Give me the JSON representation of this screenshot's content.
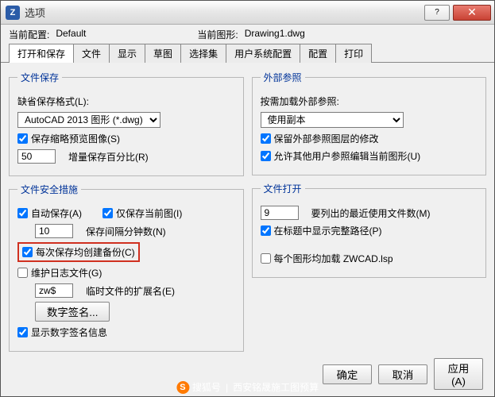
{
  "window": {
    "title": "选项"
  },
  "info": {
    "currentProfileLabel": "当前配置:",
    "currentProfileValue": "Default",
    "currentDrawingLabel": "当前图形:",
    "currentDrawingValue": "Drawing1.dwg"
  },
  "tabs": [
    "打开和保存",
    "文件",
    "显示",
    "草图",
    "选择集",
    "用户系统配置",
    "配置",
    "打印"
  ],
  "left": {
    "fileSave": {
      "legend": "文件保存",
      "defaultFormatLabel": "缺省保存格式(L):",
      "format": "AutoCAD 2013 图形 (*.dwg)",
      "thumbnail": "保存缩略预览图像(S)",
      "incrementValue": "50",
      "incrementLabel": "增量保存百分比(R)"
    },
    "safety": {
      "legend": "文件安全措施",
      "autoSave": "自动保存(A)",
      "onlyCurrent": "仅保存当前图(I)",
      "intervalValue": "10",
      "intervalLabel": "保存间隔分钟数(N)",
      "backup": "每次保存均创建备份(C)",
      "logFile": "维护日志文件(G)",
      "tempExtValue": "zw$",
      "tempExtLabel": "临时文件的扩展名(E)",
      "signatureBtn": "数字签名...",
      "showSignature": "显示数字签名信息"
    }
  },
  "right": {
    "xref": {
      "legend": "外部参照",
      "loadLabel": "按需加载外部参照:",
      "loadValue": "使用副本",
      "retainLayers": "保留外部参照图层的修改",
      "allowEdit": "允许其他用户参照编辑当前图形(U)"
    },
    "fileOpen": {
      "legend": "文件打开",
      "recentValue": "9",
      "recentLabel": "要列出的最近使用文件数(M)",
      "fullPath": "在标题中显示完整路径(P)",
      "loadLsp": "每个图形均加载 ZWCAD.lsp"
    }
  },
  "footer": {
    "ok": "确定",
    "cancel": "取消",
    "apply": "应用(A)"
  },
  "watermark": {
    "prefix": "搜狐号",
    "text": "西安铭晟施工图预算"
  }
}
